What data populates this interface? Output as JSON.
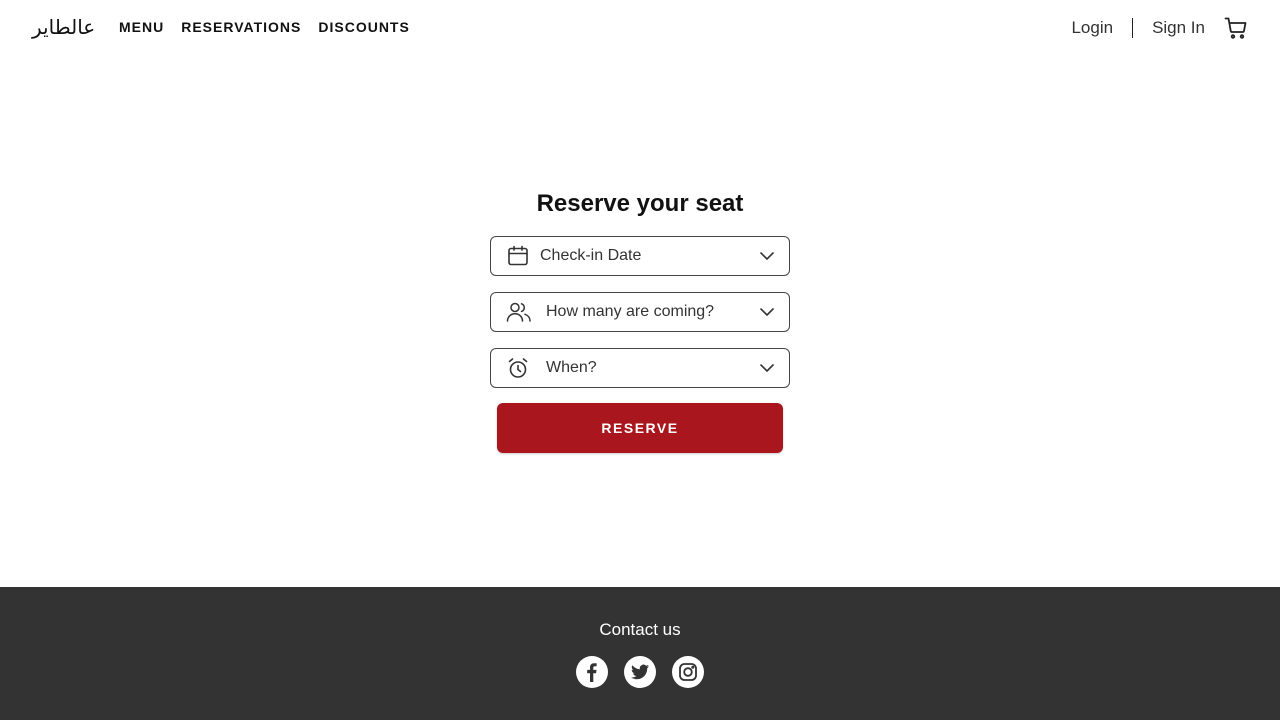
{
  "header": {
    "logo_text": "عالطاير",
    "nav": [
      {
        "label": "MENU",
        "name": "nav-menu"
      },
      {
        "label": "RESERVATIONS",
        "name": "nav-reservations"
      },
      {
        "label": "DISCOUNTS",
        "name": "nav-discounts"
      }
    ],
    "login_label": "Login",
    "signin_label": "Sign In",
    "cart_icon": "cart-icon"
  },
  "reservation": {
    "title": "Reserve your seat",
    "fields": [
      {
        "placeholder": "Check-in Date",
        "icon": "calendar-icon"
      },
      {
        "placeholder": "How many are coming?",
        "icon": "people-icon"
      },
      {
        "placeholder": "When?",
        "icon": "alarm-clock-icon"
      }
    ],
    "button_label": "RESERVE",
    "accent_color": "#aa161d"
  },
  "footer": {
    "contact_label": "Contact us",
    "background_color": "#333333",
    "socials": [
      "facebook-icon",
      "twitter-icon",
      "instagram-icon"
    ]
  }
}
